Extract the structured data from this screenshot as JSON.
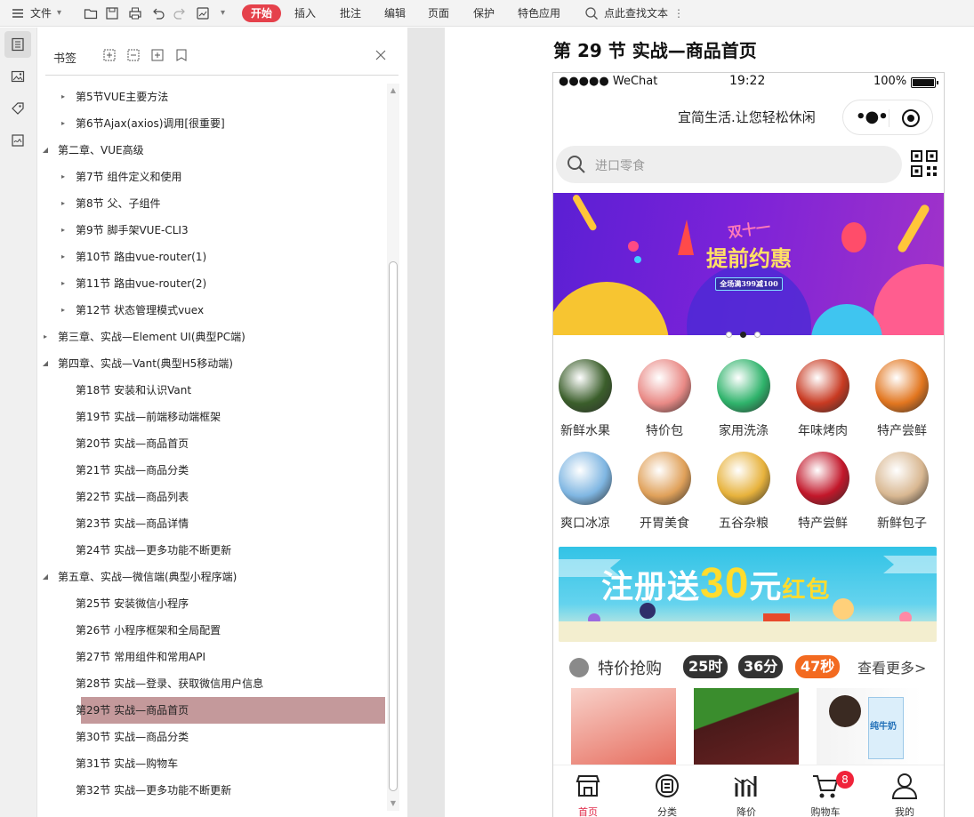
{
  "toolbar": {
    "menu_label": "文件",
    "start_label": "开始",
    "tabs": [
      "插入",
      "批注",
      "编辑",
      "页面",
      "保护",
      "特色应用"
    ],
    "search_placeholder": "点此查找文本",
    "accent": "#e5414b"
  },
  "panel": {
    "title": "书签",
    "items": [
      {
        "label": "第5节VUE主要方法",
        "level": 2,
        "caret": "right"
      },
      {
        "label": "第6节Ajax(axios)调用[很重要]",
        "level": 2,
        "caret": "right"
      },
      {
        "label": "第二章、VUE高级",
        "level": 1,
        "caret": "down"
      },
      {
        "label": "第7节 组件定义和使用",
        "level": 2,
        "caret": "right"
      },
      {
        "label": "第8节 父、子组件",
        "level": 2,
        "caret": "right"
      },
      {
        "label": "第9节 脚手架VUE-CLI3",
        "level": 2,
        "caret": "right"
      },
      {
        "label": "第10节 路由vue-router(1)",
        "level": 2,
        "caret": "right"
      },
      {
        "label": "第11节 路由vue-router(2)",
        "level": 2,
        "caret": "right"
      },
      {
        "label": "第12节 状态管理模式vuex",
        "level": 2,
        "caret": "right"
      },
      {
        "label": "第三章、实战—Element UI(典型PC端)",
        "level": 1,
        "caret": "right"
      },
      {
        "label": "第四章、实战—Vant(典型H5移动端)",
        "level": 1,
        "caret": "down"
      },
      {
        "label": "第18节 安装和认识Vant",
        "level": 2,
        "caret": "none"
      },
      {
        "label": "第19节 实战—前端移动端框架",
        "level": 2,
        "caret": "none"
      },
      {
        "label": "第20节 实战—商品首页",
        "level": 2,
        "caret": "none"
      },
      {
        "label": "第21节 实战—商品分类",
        "level": 2,
        "caret": "none"
      },
      {
        "label": "第22节 实战—商品列表",
        "level": 2,
        "caret": "none"
      },
      {
        "label": "第23节 实战—商品详情",
        "level": 2,
        "caret": "none"
      },
      {
        "label": "第24节 实战—更多功能不断更新",
        "level": 2,
        "caret": "none"
      },
      {
        "label": "第五章、实战—微信端(典型小程序端)",
        "level": 1,
        "caret": "down"
      },
      {
        "label": "第25节 安装微信小程序",
        "level": 2,
        "caret": "none"
      },
      {
        "label": "第26节 小程序框架和全局配置",
        "level": 2,
        "caret": "none"
      },
      {
        "label": "第27节 常用组件和常用API",
        "level": 2,
        "caret": "none"
      },
      {
        "label": "第28节 实战—登录、获取微信用户信息",
        "level": 2,
        "caret": "none"
      },
      {
        "label": "第29节 实战—商品首页",
        "level": 2,
        "caret": "none",
        "selected": true
      },
      {
        "label": "第30节 实战—商品分类",
        "level": 2,
        "caret": "none"
      },
      {
        "label": "第31节 实战—购物车",
        "level": 2,
        "caret": "none"
      },
      {
        "label": "第32节 实战—更多功能不断更新",
        "level": 2,
        "caret": "none"
      }
    ],
    "selected_color": "#c4999b"
  },
  "doc": {
    "heading": "第 29 节  实战—商品首页"
  },
  "phone": {
    "carrier": "●●●●● WeChat",
    "time": "19:22",
    "battery": "100%",
    "page_title": "宜简生活.让您轻松休闲",
    "search_placeholder": "进口零食",
    "banner": {
      "line1": "双十一",
      "line2": "提前约惠",
      "line3": "全场满399减100"
    },
    "categories": [
      {
        "label": "新鲜水果",
        "color": "#3b5e2b"
      },
      {
        "label": "特价包",
        "color": "#e98a86"
      },
      {
        "label": "家用洗涤",
        "color": "#2fb36b"
      },
      {
        "label": "年味烤肉",
        "color": "#c83a22"
      },
      {
        "label": "特产尝鲜",
        "color": "#e2761f"
      },
      {
        "label": "爽口冰凉",
        "color": "#7fb6e2"
      },
      {
        "label": "开胃美食",
        "color": "#e0a15a"
      },
      {
        "label": "五谷杂粮",
        "color": "#e7b23c"
      },
      {
        "label": "特产尝鲜",
        "color": "#c2172a"
      },
      {
        "label": "新鲜包子",
        "color": "#d9b892"
      }
    ],
    "promo": {
      "prefix": "注册送",
      "amount": "30",
      "unit": "元",
      "tail": "红包"
    },
    "sale": {
      "title": "特价抢购",
      "hours": "25时",
      "minutes": "36分",
      "seconds": "47秒",
      "more": "查看更多>"
    },
    "tabs": [
      {
        "label": "首页",
        "icon": "shop-icon"
      },
      {
        "label": "分类",
        "icon": "category-icon"
      },
      {
        "label": "降价",
        "icon": "price-drop-icon"
      },
      {
        "label": "购物车",
        "icon": "cart-icon",
        "badge": "8"
      },
      {
        "label": "我的",
        "icon": "user-icon"
      }
    ],
    "product_name": "纯牛奶"
  }
}
